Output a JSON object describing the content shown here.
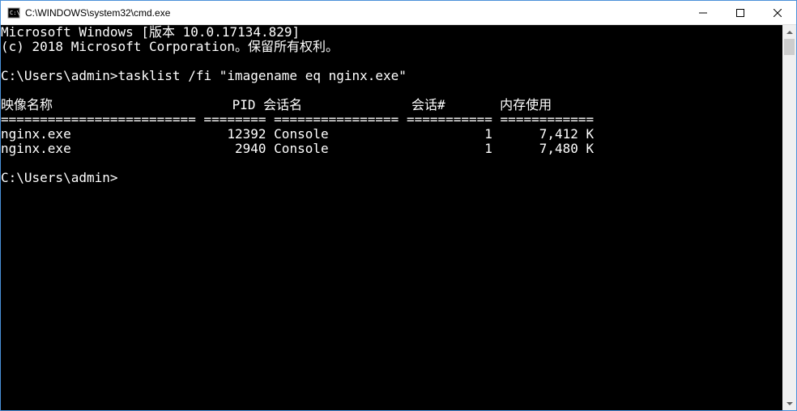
{
  "window": {
    "title": "C:\\WINDOWS\\system32\\cmd.exe"
  },
  "terminal": {
    "banner_line1": "Microsoft Windows [版本 10.0.17134.829]",
    "banner_line2": "(c) 2018 Microsoft Corporation。保留所有权利。",
    "prompt1": "C:\\Users\\admin>",
    "command1": "tasklist /fi \"imagename eq nginx.exe\"",
    "header": {
      "image_name": "映像名称",
      "pid": "PID",
      "session_name": "会话名",
      "session_num": "会话#",
      "mem_usage": "内存使用"
    },
    "separator": {
      "col1": "=========================",
      "col2": "========",
      "col3": "================",
      "col4": "===========",
      "col5": "============"
    },
    "rows": [
      {
        "image_name": "nginx.exe",
        "pid": "12392",
        "session_name": "Console",
        "session_num": "1",
        "mem_usage": "7,412 K"
      },
      {
        "image_name": "nginx.exe",
        "pid": "2940",
        "session_name": "Console",
        "session_num": "1",
        "mem_usage": "7,480 K"
      }
    ],
    "prompt2": "C:\\Users\\admin>"
  }
}
